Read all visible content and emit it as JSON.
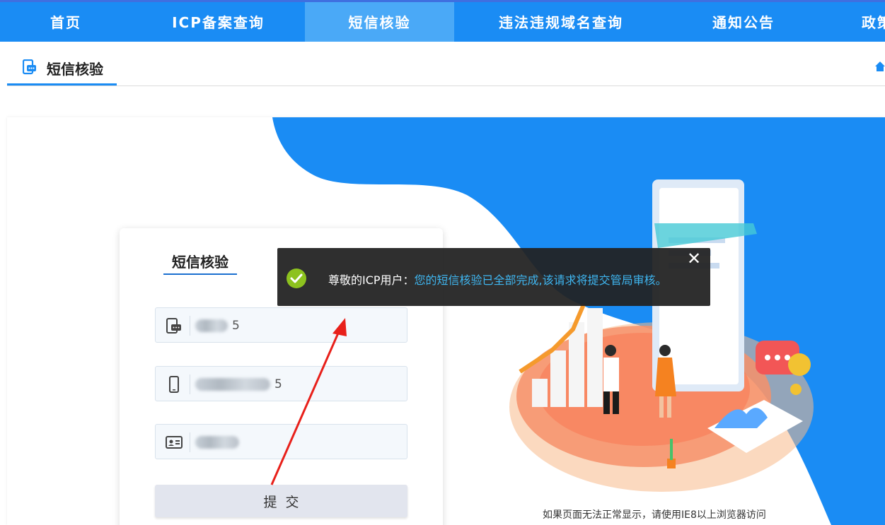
{
  "nav": {
    "items": [
      "首页",
      "ICP备案查询",
      "短信核验",
      "违法违规域名查询",
      "通知公告",
      "政策"
    ],
    "active_index": 2
  },
  "page": {
    "title": "短信核验"
  },
  "form": {
    "tab_label": "短信核验",
    "fields": [
      {
        "icon": "sms-verify-icon",
        "value": "5"
      },
      {
        "icon": "mobile-phone-icon",
        "value": "5"
      },
      {
        "icon": "id-card-icon",
        "value": ""
      }
    ],
    "submit_label": "提交"
  },
  "footer_note": "如果页面无法正常显示，请使用IE8以上浏览器访问",
  "toast": {
    "prefix": "尊敬的ICP用户：",
    "message": "您的短信核验已全部完成,该请求将提交管局审核。",
    "close_symbol": "✕",
    "status": "success"
  },
  "colors": {
    "nav_bg": "#1a8cf4",
    "nav_active": "#4aa9f7",
    "accent_blue": "#1a8cf4",
    "toast_bg": "#222222",
    "toast_highlight": "#3fb6f0",
    "success_green": "#8dc21f",
    "annotation_arrow": "#e8201a"
  }
}
